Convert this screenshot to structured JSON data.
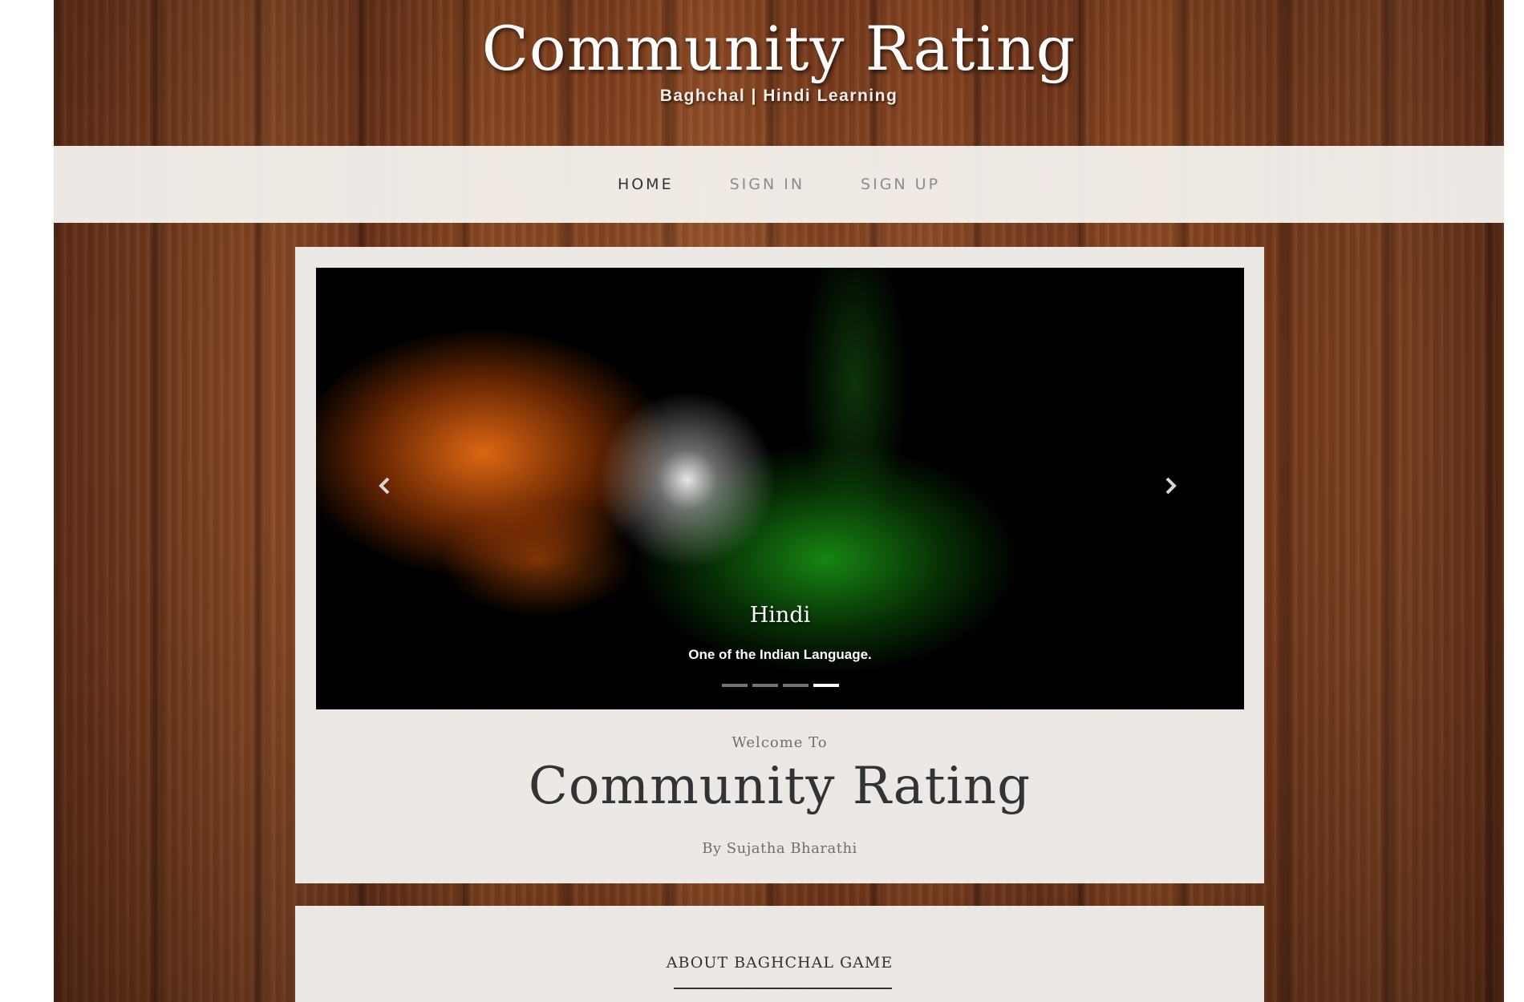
{
  "header": {
    "title": "Community Rating",
    "subtitle": "Baghchal | Hindi Learning"
  },
  "nav": {
    "items": [
      {
        "label": "HOME",
        "active": true
      },
      {
        "label": "SIGN IN",
        "active": false
      },
      {
        "label": "SIGN UP",
        "active": false
      }
    ]
  },
  "carousel": {
    "caption_title": "Hindi",
    "caption_text": "One of the Indian Language.",
    "prev_icon": "chevron-left-icon",
    "next_icon": "chevron-right-icon",
    "indicator_count": 4,
    "active_indicator": 3
  },
  "welcome": {
    "intro": "Welcome To",
    "title": "Community Rating",
    "byline": "By Sujatha Bharathi"
  },
  "about": {
    "heading": "ABOUT BAGHCHAL GAME"
  },
  "colors": {
    "wood": "#7a3c1c",
    "panel": "#f0edeb",
    "text_dark": "#333333",
    "text_muted": "#8c8c8c"
  }
}
